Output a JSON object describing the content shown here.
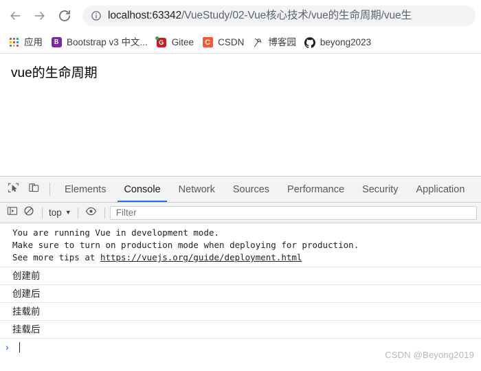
{
  "browser": {
    "nav": {
      "back_icon": "arrow-left-icon",
      "forward_icon": "arrow-right-icon",
      "reload_icon": "reload-icon"
    },
    "omnibox": {
      "site_info_icon": "info-circle-icon",
      "host": "localhost:63342",
      "path": "/VueStudy/02-Vue核心技术/vue的生命周期/vue生"
    },
    "bookmarks": [
      {
        "label": "应用",
        "icon": "apps-grid-icon"
      },
      {
        "label": "Bootstrap v3 中文...",
        "icon": "bootstrap-icon",
        "glyph": "B"
      },
      {
        "label": "Gitee",
        "icon": "gitee-icon",
        "glyph": "G"
      },
      {
        "label": "CSDN",
        "icon": "csdn-icon",
        "glyph": "C"
      },
      {
        "label": "博客园",
        "icon": "cnblogs-icon"
      },
      {
        "label": "beyong2023",
        "icon": "github-icon"
      }
    ]
  },
  "page": {
    "heading": "vue的生命周期"
  },
  "devtools": {
    "inspect_icon": "inspect-element-icon",
    "device_icon": "device-toolbar-icon",
    "tabs": [
      {
        "label": "Elements",
        "active": false
      },
      {
        "label": "Console",
        "active": true
      },
      {
        "label": "Network",
        "active": false
      },
      {
        "label": "Sources",
        "active": false
      },
      {
        "label": "Performance",
        "active": false
      },
      {
        "label": "Security",
        "active": false
      },
      {
        "label": "Application",
        "active": false
      }
    ],
    "console_toolbar": {
      "sidebar_icon": "show-console-sidebar-icon",
      "clear_icon": "clear-console-icon",
      "context": "top",
      "context_caret": "▼",
      "eye_icon": "live-expression-eye-icon",
      "filter_placeholder": "Filter"
    },
    "console": {
      "vue_message": {
        "line1": "You are running Vue in development mode.",
        "line2": "Make sure to turn on production mode when deploying for production.",
        "line3_prefix": "See more tips at ",
        "link": "https://vuejs.org/guide/deployment.html"
      },
      "logs": [
        "创建前",
        "创建后",
        "挂载前",
        "挂载后"
      ],
      "prompt_caret": "›"
    },
    "watermark": "CSDN @Beyong2019"
  },
  "colors": {
    "accent_blue": "#1a73e8",
    "prompt_blue": "#4285f4",
    "omnibox_bg": "#f1f3f4",
    "devtools_bg": "#f3f3f3",
    "csdn_orange": "#fc5531",
    "gitee_red": "#c71d23",
    "bootstrap_purple": "#7a28a3"
  }
}
